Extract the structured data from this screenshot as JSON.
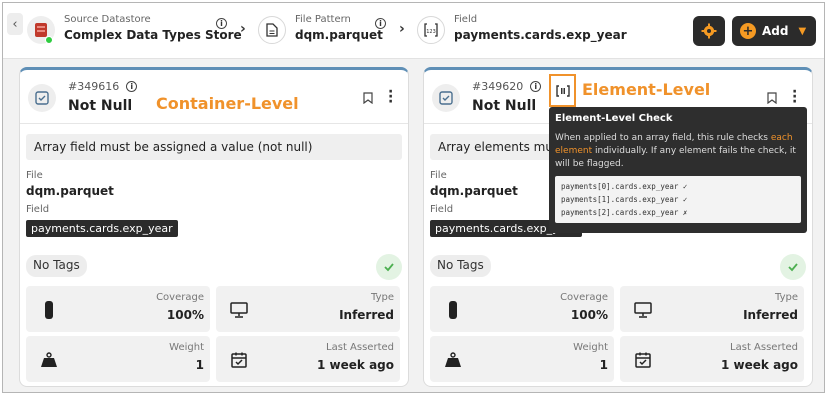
{
  "breadcrumb": {
    "datastore": {
      "label": "Source Datastore",
      "value": "Complex Data Types Store"
    },
    "file_pattern": {
      "label": "File Pattern",
      "value": "dqm.parquet"
    },
    "field": {
      "label": "Field",
      "value": "payments.cards.exp_year"
    }
  },
  "toolbar": {
    "add_label": "Add"
  },
  "cards": [
    {
      "id": "#349616",
      "name": "Not Null",
      "level_label": "Container-Level",
      "description": "Array field must be assigned a value (not null)",
      "file_label": "File",
      "file_value": "dqm.parquet",
      "field_label": "Field",
      "field_value": "payments.cards.exp_year",
      "tags": "No Tags",
      "stats": {
        "coverage_label": "Coverage",
        "coverage_value": "100%",
        "type_label": "Type",
        "type_value": "Inferred",
        "weight_label": "Weight",
        "weight_value": "1",
        "asserted_label": "Last Asserted",
        "asserted_value": "1 week ago"
      }
    },
    {
      "id": "#349620",
      "name": "Not Null",
      "level_label": "Element-Level",
      "description": "Array elements must be assigned a value (not null)",
      "file_label": "File",
      "file_value": "dqm.parquet",
      "field_label": "Field",
      "field_value": "payments.cards.exp_year",
      "tags": "No Tags",
      "stats": {
        "coverage_label": "Coverage",
        "coverage_value": "100%",
        "type_label": "Type",
        "type_value": "Inferred",
        "weight_label": "Weight",
        "weight_value": "1",
        "asserted_label": "Last Asserted",
        "asserted_value": "1 week ago"
      }
    }
  ],
  "tooltip": {
    "title": "Element-Level Check",
    "body_pre": "When applied to an array field, this rule checks ",
    "body_highlight": "each element",
    "body_post": " individually. If any element fails the check, it will be flagged.",
    "code_lines": [
      "payments[0].cards.exp_year ✓",
      "payments[1].cards.exp_year ✓",
      "payments[2].cards.exp_year ✗"
    ]
  },
  "colors": {
    "accent": "#f0922b",
    "dark": "#2b2b2b",
    "card_top": "#5f8fb6",
    "success": "#4caf50"
  }
}
